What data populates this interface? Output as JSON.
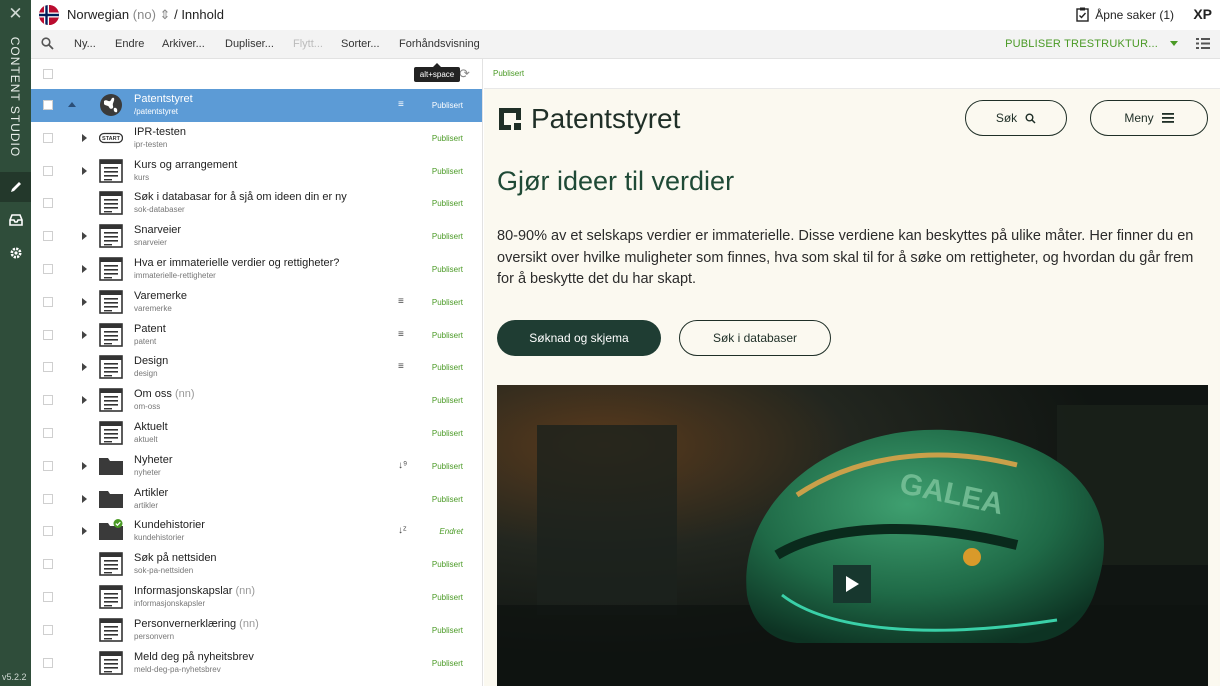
{
  "app": {
    "brand": "CONTENT STUDIO",
    "version": "v5.2.2",
    "language": "Norwegian",
    "language_code": "(no)",
    "breadcrumb_separator": "/",
    "breadcrumb_section": "Innhold",
    "open_issues": "Åpne saker (1)",
    "xp": "XP"
  },
  "toolbar": {
    "new": "Ny...",
    "edit": "Endre",
    "archive": "Arkiver...",
    "duplicate": "Dupliser...",
    "move": "Flytt...",
    "sort": "Sorter...",
    "preview": "Forhåndsvisning",
    "publish": "PUBLISER TRESTRUKTUR...",
    "tooltip": "alt+space"
  },
  "tree": {
    "rows": [
      {
        "name": "Patentstyret",
        "path": "/patentstyret",
        "status": "Publisert",
        "icon": "globe-icon",
        "selected": true,
        "mark": "≡"
      },
      {
        "name": "IPR-testen",
        "path": "ipr-testen",
        "status": "Publisert",
        "icon": "start-icon",
        "expandable": true
      },
      {
        "name": "Kurs og arrangement",
        "path": "kurs",
        "status": "Publisert",
        "icon": "page-icon",
        "expandable": true
      },
      {
        "name": "Søk i databasar for å sjå om ideen din er ny",
        "path": "sok-databaser",
        "status": "Publisert",
        "icon": "page-icon"
      },
      {
        "name": "Snarveier",
        "path": "snarveier",
        "status": "Publisert",
        "icon": "page-icon",
        "expandable": true
      },
      {
        "name": "Hva er immaterielle verdier og rettigheter?",
        "path": "immaterielle-rettigheter",
        "status": "Publisert",
        "icon": "page-icon",
        "expandable": true
      },
      {
        "name": "Varemerke",
        "path": "varemerke",
        "status": "Publisert",
        "icon": "page-icon",
        "expandable": true,
        "mark": "≡"
      },
      {
        "name": "Patent",
        "path": "patent",
        "status": "Publisert",
        "icon": "page-icon",
        "expandable": true,
        "mark": "≡"
      },
      {
        "name": "Design",
        "path": "design",
        "status": "Publisert",
        "icon": "page-icon",
        "expandable": true,
        "mark": "≡"
      },
      {
        "name": "Om oss",
        "lang": "(nn)",
        "path": "om-oss",
        "status": "Publisert",
        "icon": "page-icon",
        "expandable": true
      },
      {
        "name": "Aktuelt",
        "path": "aktuelt",
        "status": "Publisert",
        "icon": "page-icon"
      },
      {
        "name": "Nyheter",
        "path": "nyheter",
        "status": "Publisert",
        "icon": "folder-icon",
        "expandable": true,
        "mark": "↓⁹"
      },
      {
        "name": "Artikler",
        "path": "artikler",
        "status": "Publisert",
        "icon": "folder-icon",
        "expandable": true
      },
      {
        "name": "Kundehistorier",
        "path": "kundehistorier",
        "status": "Endret",
        "icon": "folder-check-icon",
        "expandable": true,
        "mark": "↓ᶻ"
      },
      {
        "name": "Søk på nettsiden",
        "path": "sok-pa-nettsiden",
        "status": "Publisert",
        "icon": "page-icon"
      },
      {
        "name": "Informasjonskapslar",
        "lang": "(nn)",
        "path": "informasjonskapsler",
        "status": "Publisert",
        "icon": "page-icon"
      },
      {
        "name": "Personvernerklæring",
        "lang": "(nn)",
        "path": "personvern",
        "status": "Publisert",
        "icon": "page-icon"
      },
      {
        "name": "Meld deg på nyheitsbrev",
        "path": "meld-deg-pa-nyhetsbrev",
        "status": "Publisert",
        "icon": "page-icon"
      }
    ]
  },
  "preview": {
    "status": "Publisert",
    "logo_text": "Patentstyret",
    "search_button": "Søk",
    "menu_button": "Meny",
    "title": "Gjør ideer til verdier",
    "body": "80-90% av et selskaps verdier er immaterielle. Disse verdiene kan beskyttes på ulike måter. Her finner du en oversikt over hvilke muligheter som finnes, hva som skal til for å søke om rettigheter, og hvordan du går frem for å beskytte det du har skapt.",
    "primary_button": "Søknad og skjema",
    "secondary_button": "Søk i databaser",
    "helmet_brand": "GALEA"
  },
  "colors": {
    "sidebar": "#2f4d3a",
    "selected_row": "#5c9bd6",
    "status_green": "#4a9a25",
    "brand_dark": "#1f3d33"
  }
}
